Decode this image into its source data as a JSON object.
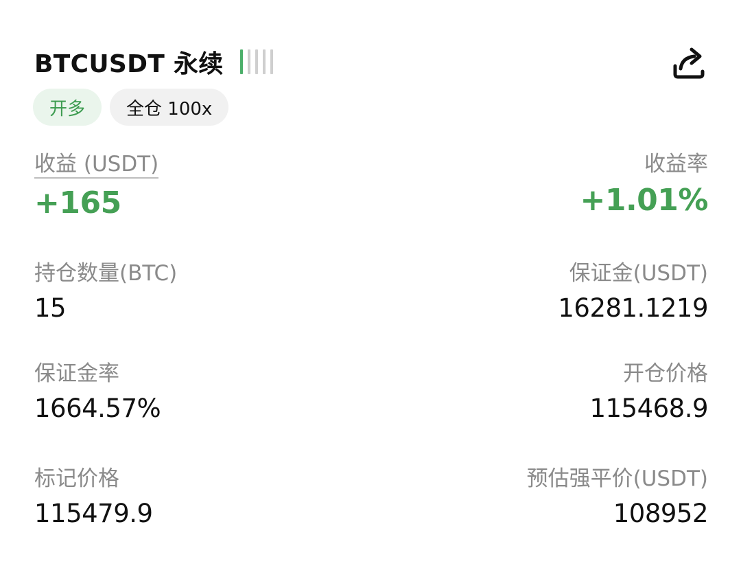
{
  "header": {
    "symbol": "BTCUSDT 永续",
    "strength_level": 1,
    "strength_total": 5,
    "accent_color": "#4caf6a"
  },
  "share": {
    "icon": "share-icon"
  },
  "tags": {
    "side": "开多",
    "margin_mode": "全仓 100x"
  },
  "pnl": {
    "label": "收益 (USDT)",
    "value": "+165",
    "rate_label": "收益率",
    "rate_value": "+1.01%",
    "positive_color": "#45a055"
  },
  "fields": {
    "position_qty": {
      "label": "持仓数量(BTC)",
      "value": "15"
    },
    "margin": {
      "label": "保证金(USDT)",
      "value": "16281.1219"
    },
    "margin_rate": {
      "label": "保证金率",
      "value": "1664.57%"
    },
    "entry_price": {
      "label": "开仓价格",
      "value": "115468.9"
    },
    "mark_price": {
      "label": "标记价格",
      "value": "115479.9"
    },
    "liq_price": {
      "label": "预估强平价(USDT)",
      "value": "108952"
    }
  }
}
